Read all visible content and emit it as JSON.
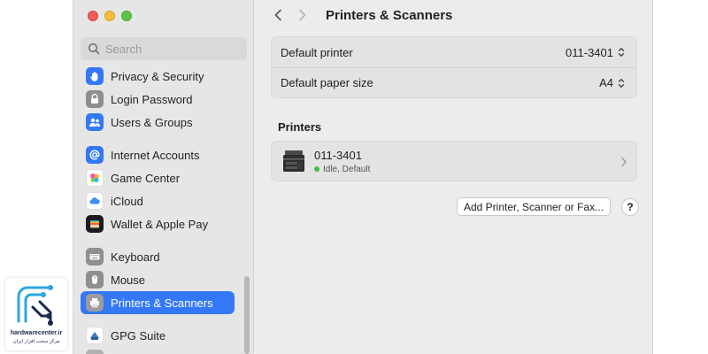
{
  "sidebar": {
    "search_placeholder": "Search",
    "items": [
      {
        "label": "Privacy & Security",
        "icon": "hand-icon",
        "color": "#3478f6"
      },
      {
        "label": "Login Password",
        "icon": "lock-icon",
        "color": "#8e8e93"
      },
      {
        "label": "Users & Groups",
        "icon": "users-icon",
        "color": "#3478f6"
      },
      {
        "label": "Internet Accounts",
        "icon": "at-icon",
        "color": "#3478f6"
      },
      {
        "label": "Game Center",
        "icon": "game-center-icon",
        "color": "#ffffff"
      },
      {
        "label": "iCloud",
        "icon": "cloud-icon",
        "color": "#ffffff"
      },
      {
        "label": "Wallet & Apple Pay",
        "icon": "wallet-icon",
        "color": "#1c1c1e"
      },
      {
        "label": "Keyboard",
        "icon": "keyboard-icon",
        "color": "#8e8e93"
      },
      {
        "label": "Mouse",
        "icon": "mouse-icon",
        "color": "#8e8e93"
      },
      {
        "label": "Printers & Scanners",
        "icon": "printer-icon",
        "color": "#8e8e93",
        "active": true
      },
      {
        "label": "GPG Suite",
        "icon": "gpg-icon",
        "color": "#ffffff"
      }
    ]
  },
  "header": {
    "title": "Printers & Scanners"
  },
  "defaults": {
    "printer_label": "Default printer",
    "printer_value": "011-3401",
    "paper_label": "Default paper size",
    "paper_value": "A4"
  },
  "printers": {
    "section_title": "Printers",
    "items": [
      {
        "name": "011-3401",
        "status": "Idle, Default",
        "status_color": "#36c24b"
      }
    ]
  },
  "actions": {
    "add_label": "Add Printer, Scanner or Fax...",
    "help_label": "?"
  },
  "watermark": {
    "url": "hardwarecenter.ir",
    "subtitle": "مرکز سخت افزار ایران"
  },
  "colors": {
    "accent": "#3478f6",
    "sidebar_bg": "#e6e6e6",
    "content_bg": "#ececec"
  }
}
